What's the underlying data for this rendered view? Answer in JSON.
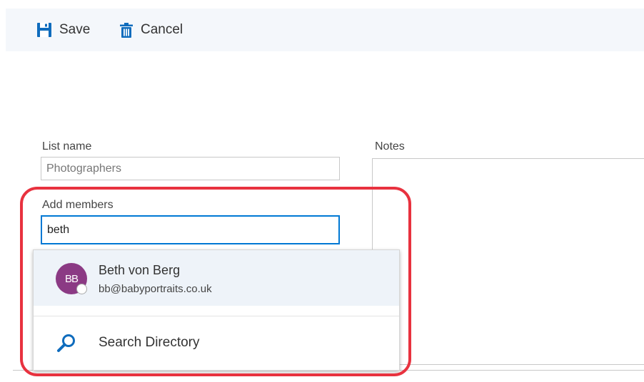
{
  "toolbar": {
    "save_label": "Save",
    "cancel_label": "Cancel",
    "save_icon": "floppy-disk-icon",
    "cancel_icon": "trash-can-icon"
  },
  "form": {
    "list_name_label": "List name",
    "list_name_value": "Photographers",
    "add_members_label": "Add members",
    "add_members_value": "beth",
    "notes_label": "Notes"
  },
  "suggestions": {
    "contact": {
      "initials": "BB",
      "name": "Beth von Berg",
      "email": "bb@babyportraits.co.uk",
      "avatar_color": "#8b3a84"
    },
    "search_directory_label": "Search Directory",
    "search_icon": "search-icon"
  },
  "colors": {
    "accent": "#0078d4",
    "highlight": "#e8323f",
    "toolbar_bg": "#f4f7fb"
  }
}
